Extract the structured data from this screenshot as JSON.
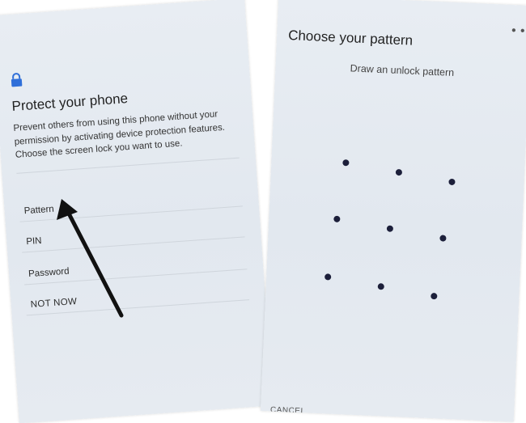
{
  "left_screen": {
    "title": "Protect your phone",
    "description": "Prevent others from using this phone without your permission by activating device protection features. Choose the screen lock you want to use.",
    "options": [
      {
        "label": "Pattern"
      },
      {
        "label": "PIN"
      },
      {
        "label": "Password"
      },
      {
        "label": "NOT NOW"
      }
    ],
    "icon": "lock-icon",
    "accent_color": "#2f6fd9",
    "annotation": "arrow pointing to Pattern"
  },
  "right_screen": {
    "title": "Choose your pattern",
    "subtitle": "Draw an unlock pattern",
    "pattern_grid": "3x3",
    "dot_color": "#1c1f3a",
    "footer_button": "CANCEL"
  }
}
